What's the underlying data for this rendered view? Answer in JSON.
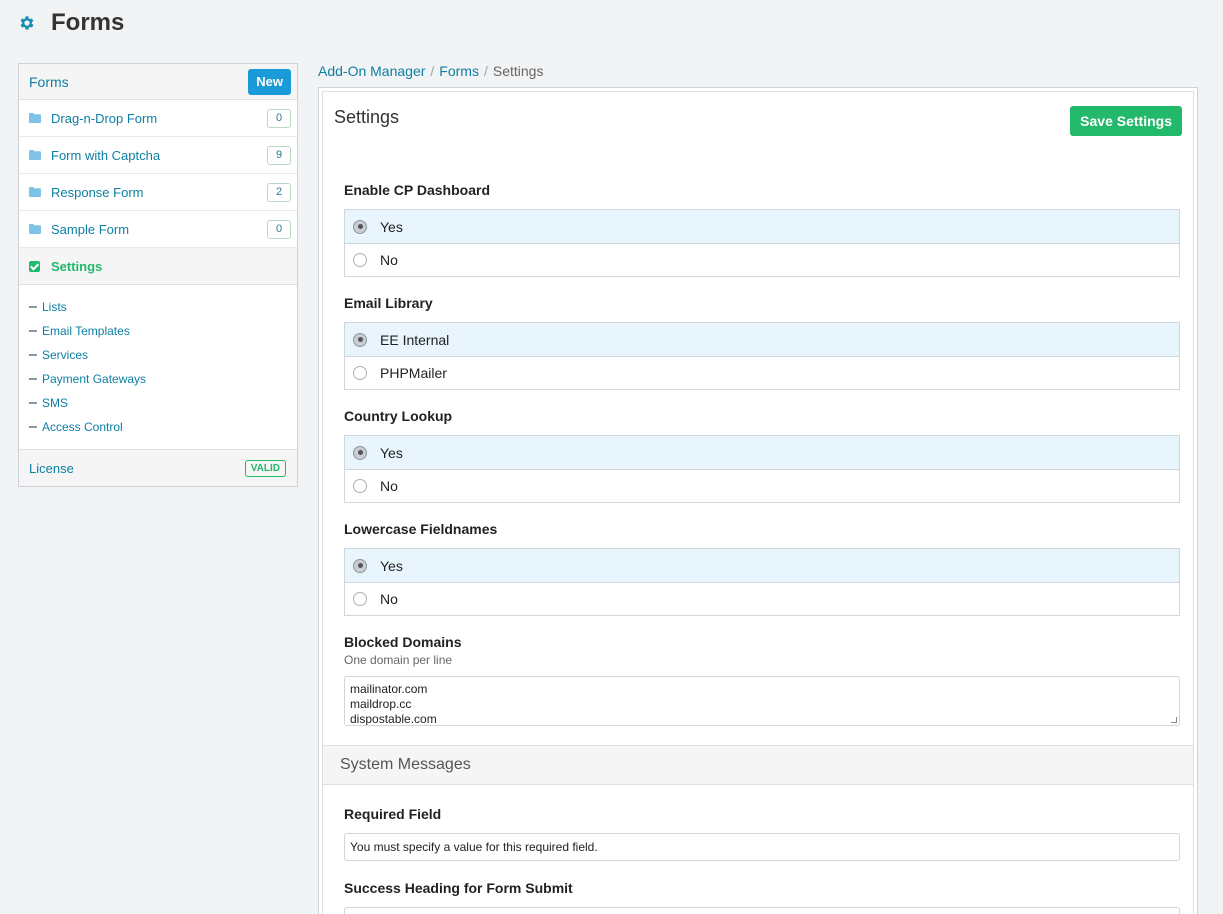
{
  "header": {
    "title": "Forms",
    "icon": "gear-icon"
  },
  "sidebar": {
    "forms_title": "Forms",
    "new_label": "New",
    "forms": [
      {
        "label": "Drag-n-Drop Form",
        "count": "0"
      },
      {
        "label": "Form with Captcha",
        "count": "9"
      },
      {
        "label": "Response Form",
        "count": "2"
      },
      {
        "label": "Sample Form",
        "count": "0"
      }
    ],
    "settings_label": "Settings",
    "settings_items": [
      {
        "label": "Lists"
      },
      {
        "label": "Email Templates"
      },
      {
        "label": "Services"
      },
      {
        "label": "Payment Gateways"
      },
      {
        "label": "SMS"
      },
      {
        "label": "Access Control"
      }
    ],
    "license_label": "License",
    "license_badge": "VALID"
  },
  "breadcrumb": {
    "items": [
      "Add-On Manager",
      "Forms"
    ],
    "current": "Settings",
    "separator": "/"
  },
  "main": {
    "title": "Settings",
    "save_label": "Save Settings",
    "fields": {
      "cp_dashboard": {
        "label": "Enable CP Dashboard",
        "options": [
          "Yes",
          "No"
        ],
        "selected": "Yes"
      },
      "email_library": {
        "label": "Email Library",
        "options": [
          "EE Internal",
          "PHPMailer"
        ],
        "selected": "EE Internal"
      },
      "country_lookup": {
        "label": "Country Lookup",
        "options": [
          "Yes",
          "No"
        ],
        "selected": "Yes"
      },
      "lowercase_fieldnames": {
        "label": "Lowercase Fieldnames",
        "options": [
          "Yes",
          "No"
        ],
        "selected": "Yes"
      },
      "blocked_domains": {
        "label": "Blocked Domains",
        "hint": "One domain per line",
        "lines": [
          "mailinator.com",
          "maildrop.cc",
          "dispostable.com"
        ]
      }
    },
    "system_messages_title": "System Messages",
    "required_field": {
      "label": "Required Field",
      "value": "You must specify a value for this required field."
    },
    "success_heading": {
      "label": "Success Heading for Form Submit"
    }
  },
  "colors": {
    "accent": "#0d7fa3",
    "success": "#22b96a",
    "primary": "#1a9ad9"
  }
}
